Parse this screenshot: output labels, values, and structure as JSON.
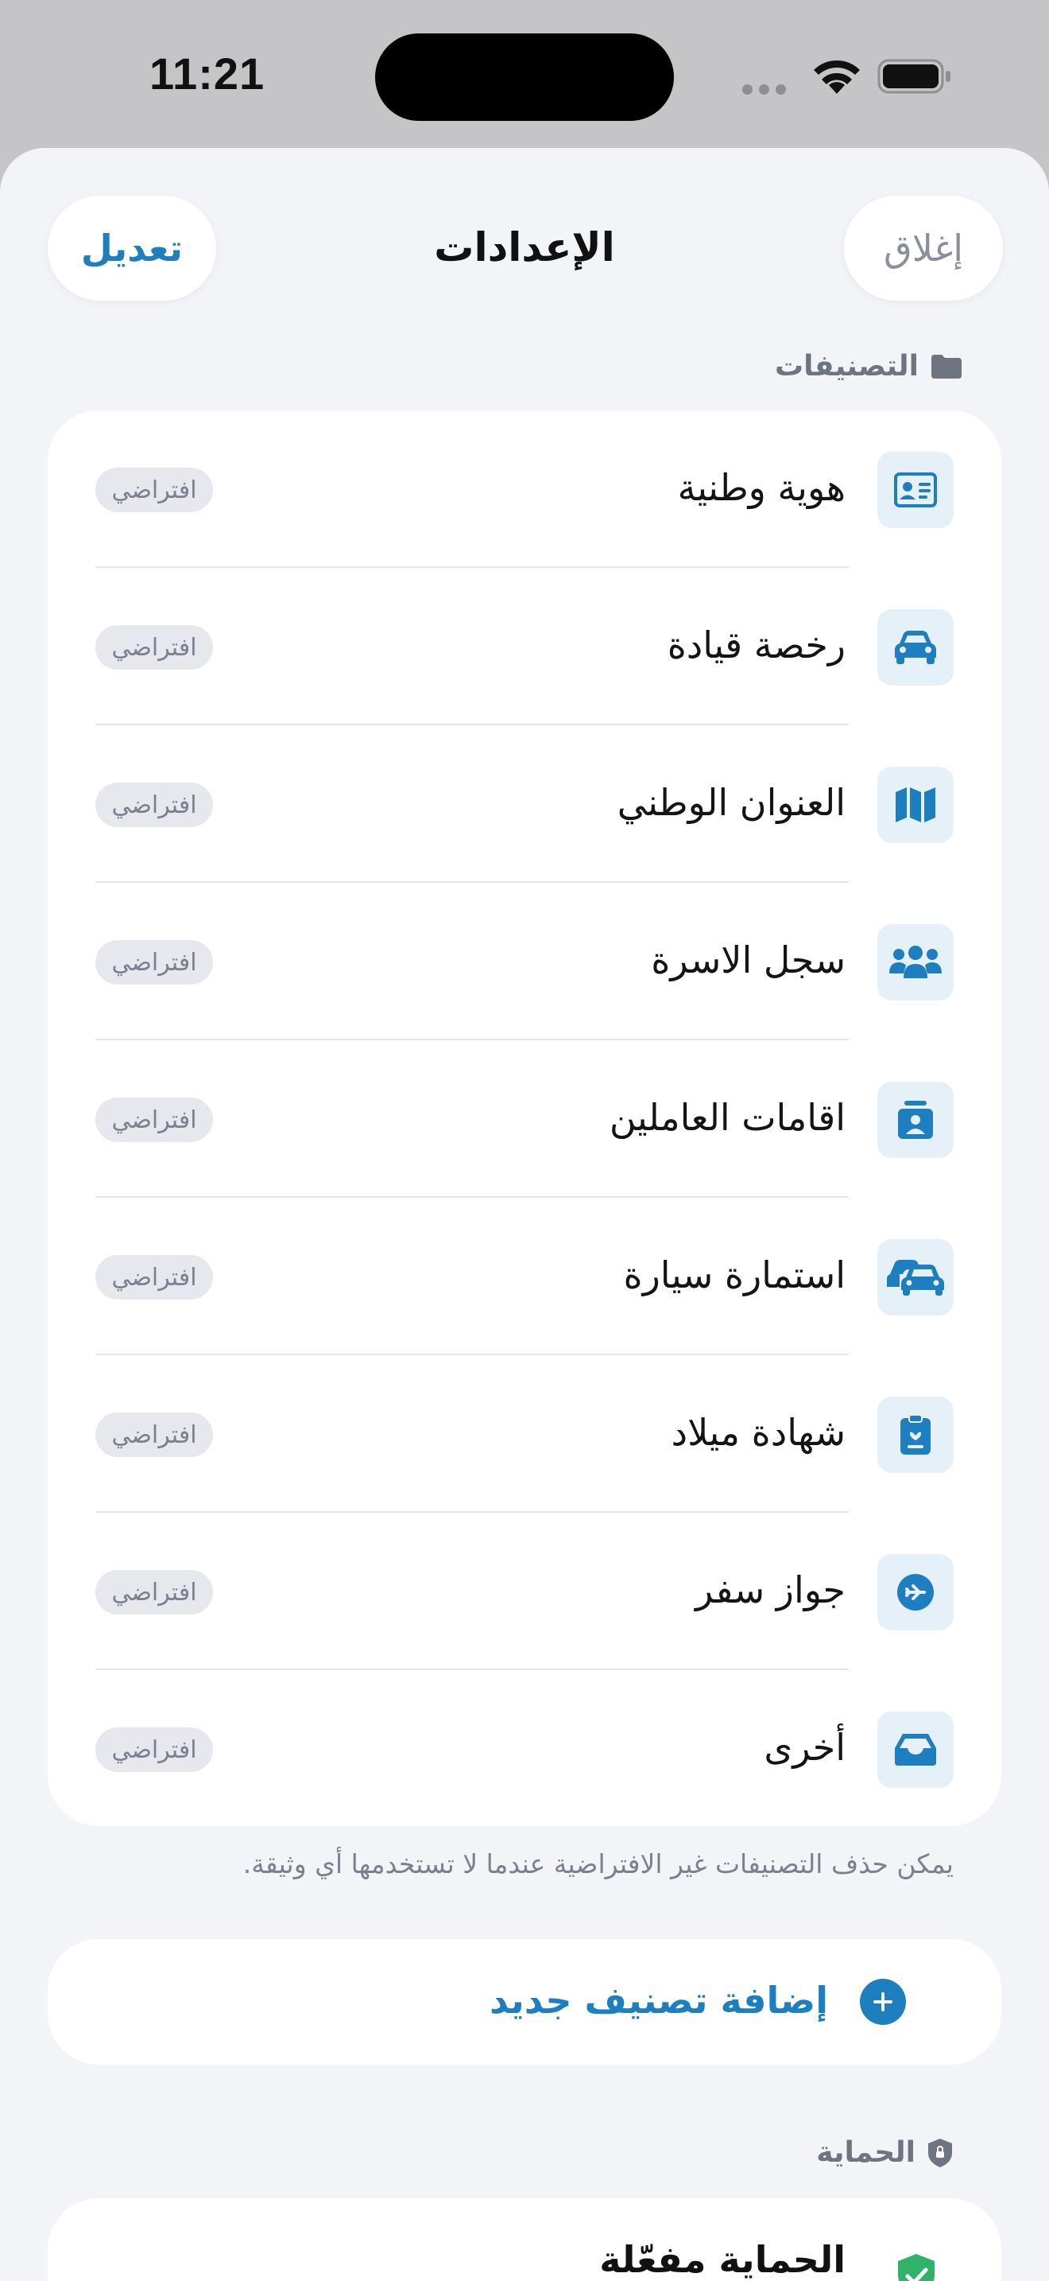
{
  "status_bar": {
    "time": "11:21"
  },
  "header": {
    "title": "الإعدادات",
    "edit_label": "تعديل",
    "close_label": "إغلاق"
  },
  "categories": {
    "section_title": "التصنيفات",
    "items": [
      {
        "label": "هوية وطنية",
        "badge": "افتراضي",
        "icon": "id-card-icon"
      },
      {
        "label": "رخصة قيادة",
        "badge": "افتراضي",
        "icon": "car-icon"
      },
      {
        "label": "العنوان الوطني",
        "badge": "افتراضي",
        "icon": "map-icon"
      },
      {
        "label": "سجل الاسرة",
        "badge": "افتراضي",
        "icon": "family-icon"
      },
      {
        "label": "اقامات العاملين",
        "badge": "افتراضي",
        "icon": "badge-icon"
      },
      {
        "label": "استمارة سيارة",
        "badge": "افتراضي",
        "icon": "cars-icon"
      },
      {
        "label": "شهادة ميلاد",
        "badge": "افتراضي",
        "icon": "clipboard-icon"
      },
      {
        "label": "جواز سفر",
        "badge": "افتراضي",
        "icon": "plane-icon"
      },
      {
        "label": "أخرى",
        "badge": "افتراضي",
        "icon": "inbox-icon"
      }
    ],
    "footnote": "يمكن حذف التصنيفات غير الافتراضية عندما لا تستخدمها أي وثيقة.",
    "add_label": "إضافة تصنيف جديد"
  },
  "protection": {
    "section_title": "الحماية",
    "status_label": "الحماية مفعّلة"
  },
  "colors": {
    "accent": "#1e7fc0",
    "sheet_bg": "#f2f4f8",
    "icon_bg": "#e6f0f8",
    "shield": "#2fb36a"
  }
}
